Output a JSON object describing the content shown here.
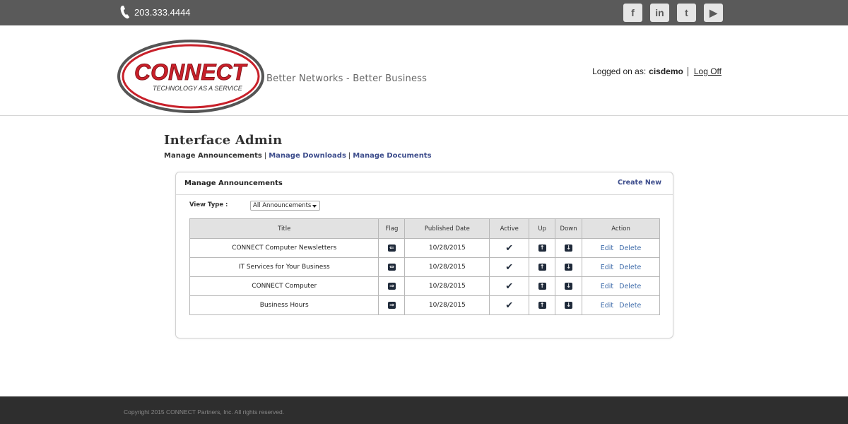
{
  "topbar": {
    "phone": "203.333.4444",
    "socials": [
      {
        "icon": "facebook-icon",
        "glyph": "f"
      },
      {
        "icon": "linkedin-icon",
        "glyph": "in"
      },
      {
        "icon": "twitter-icon",
        "glyph": "t"
      },
      {
        "icon": "youtube-icon",
        "glyph": "▶"
      }
    ]
  },
  "header": {
    "logo_text": "CONNECT",
    "logo_subtext": "TECHNOLOGY AS A SERVICE",
    "tagline": "Better Networks - Better Business",
    "login_label": "Logged on as:",
    "username": "cisdemo",
    "logoff": "Log Off"
  },
  "main": {
    "title": "Interface Admin",
    "subnav": {
      "current": "Manage Announcements",
      "downloads": "Manage Downloads",
      "documents": "Manage Documents",
      "separator": "|"
    },
    "panel": {
      "title": "Manage Announcements",
      "create_new": "Create New",
      "view_type_label": "View Type :",
      "view_type_value": "All Announcements"
    },
    "table": {
      "headers": [
        "Title",
        "Flag",
        "Published Date",
        "Active",
        "Up",
        "Down",
        "Action"
      ],
      "rows": [
        {
          "title": "CONNECT Computer Newsletters",
          "flag": "left",
          "date": "10/28/2015",
          "active": "✔",
          "edit": "Edit",
          "delete": "Delete"
        },
        {
          "title": "IT Services for Your Business",
          "flag": "both",
          "date": "10/28/2015",
          "active": "✔",
          "edit": "Edit",
          "delete": "Delete"
        },
        {
          "title": "CONNECT Computer",
          "flag": "right",
          "date": "10/28/2015",
          "active": "✔",
          "edit": "Edit",
          "delete": "Delete"
        },
        {
          "title": "Business Hours",
          "flag": "right",
          "date": "10/28/2015",
          "active": "✔",
          "edit": "Edit",
          "delete": "Delete"
        }
      ]
    }
  },
  "footer": {
    "copyright": "Copyright 2015 CONNECT Partners, Inc. All rights reserved."
  },
  "colors": {
    "topbar": "#5a5a5a",
    "footer": "#2e2e2e",
    "link": "#3d4d8c",
    "logo_red": "#c8202a",
    "icon_dark": "#1f2a3a"
  }
}
